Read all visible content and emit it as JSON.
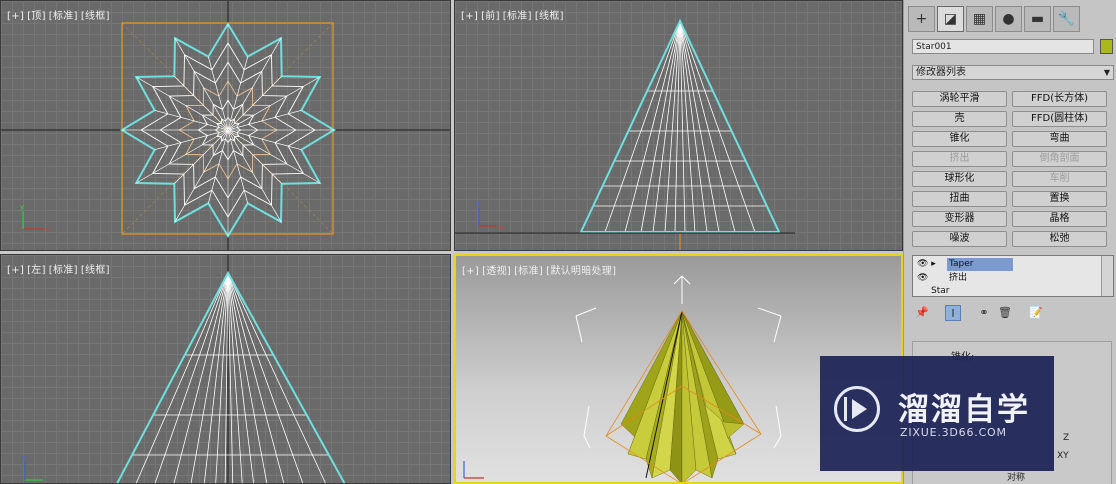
{
  "viewports": {
    "top": {
      "labels": [
        "[+]",
        "[顶]",
        "[标准]",
        "[线框]"
      ]
    },
    "front": {
      "labels": [
        "[+]",
        "[前]",
        "[标准]",
        "[线框]"
      ]
    },
    "left": {
      "labels": [
        "[+]",
        "[左]",
        "[标准]",
        "[线框]"
      ]
    },
    "perspective": {
      "labels": [
        "[+]",
        "[透视]",
        "[标准]",
        "[默认明暗处理]"
      ]
    }
  },
  "command_panel": {
    "tabs": [
      {
        "name": "create",
        "icon": "+"
      },
      {
        "name": "modify",
        "icon": "◪"
      },
      {
        "name": "hierarchy",
        "icon": "▦"
      },
      {
        "name": "motion",
        "icon": "●"
      },
      {
        "name": "display",
        "icon": "▬"
      },
      {
        "name": "utilities",
        "icon": "🔧"
      }
    ],
    "object_name": "Star001",
    "object_color": "#aab81c",
    "modifier_list_label": "修改器列表",
    "modifier_buttons": [
      [
        "涡轮平滑",
        "FFD(长方体)"
      ],
      [
        "壳",
        "FFD(圆柱体)"
      ],
      [
        "锥化",
        "弯曲"
      ],
      [
        "挤出",
        "倒角剖面"
      ],
      [
        "球形化",
        "车削"
      ],
      [
        "扭曲",
        "置换"
      ],
      [
        "变形器",
        "晶格"
      ],
      [
        "噪波",
        "松弛"
      ]
    ],
    "disabled_buttons": [
      "挤出",
      "倒角剖面",
      "车削"
    ],
    "stack": [
      "Taper",
      "挤出",
      "Star"
    ],
    "rollout_title": "锥化:",
    "rollout_axis_labels": [
      "Z",
      "XY"
    ],
    "rollout_checkbox_label": "对称"
  },
  "watermark": {
    "title": "溜溜自学",
    "url": "ZIXUE.3D66.COM"
  }
}
